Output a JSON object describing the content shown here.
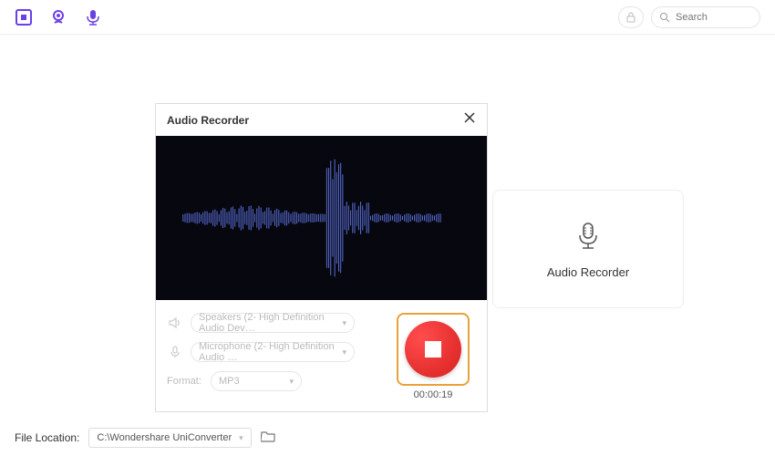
{
  "topbar": {
    "search_placeholder": "Search"
  },
  "card": {
    "label": "Audio Recorder"
  },
  "modal": {
    "title": "Audio Recorder",
    "speaker_device": "Speakers (2- High Definition Audio Dev…",
    "microphone_device": "Microphone (2- High Definition Audio …",
    "format_label": "Format:",
    "format_value": "MP3",
    "timer": "00:00:19"
  },
  "footer": {
    "label": "File Location:",
    "path": "C:\\Wondershare UniConverter"
  }
}
